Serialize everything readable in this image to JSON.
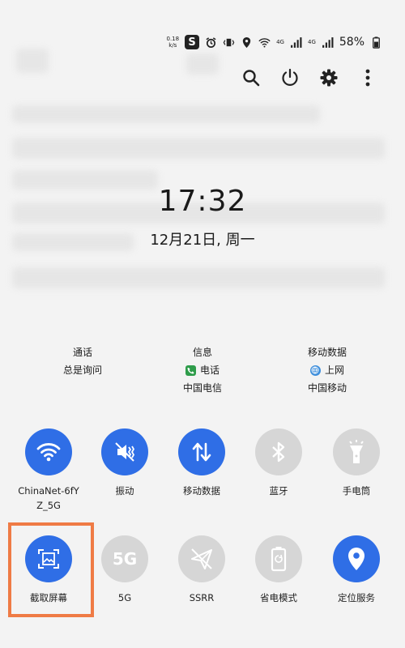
{
  "status_bar": {
    "speed": "0.18\nk/s",
    "net_type": "4G",
    "signal": "4G",
    "battery": "58%"
  },
  "top_actions": [
    {
      "name": "search-icon"
    },
    {
      "name": "power-icon"
    },
    {
      "name": "gear-icon"
    },
    {
      "name": "more-vertical-icon"
    }
  ],
  "clock": {
    "time": "17:32",
    "date": "12月21日, 周一"
  },
  "sim_info": {
    "col1": {
      "title": "通话",
      "sub": "总是询问"
    },
    "col2": {
      "title": "信息",
      "app": "电话",
      "carrier": "中国电信"
    },
    "col3": {
      "title": "移动数据",
      "app": "上网",
      "carrier": "中国移动"
    }
  },
  "tiles": [
    {
      "label": "ChinaNet-6fY\nZ_5G",
      "icon": "wifi-icon",
      "active": true
    },
    {
      "label": "振动",
      "icon": "vibrate-icon",
      "active": true
    },
    {
      "label": "移动数据",
      "icon": "mobile-data-icon",
      "active": true
    },
    {
      "label": "蓝牙",
      "icon": "bluetooth-icon",
      "active": false
    },
    {
      "label": "手电筒",
      "icon": "flashlight-icon",
      "active": false
    },
    {
      "label": "截取屏幕",
      "icon": "screenshot-icon",
      "active": true
    },
    {
      "label": "5G",
      "icon": "5g-icon",
      "active": false,
      "icon_text": "5G"
    },
    {
      "label": "SSRR",
      "icon": "ssrr-icon",
      "active": false
    },
    {
      "label": "省电模式",
      "icon": "battery-saver-icon",
      "active": false
    },
    {
      "label": "定位服务",
      "icon": "location-icon",
      "active": true
    }
  ],
  "colors": {
    "active": "#2f6ee6",
    "inactive": "#d6d6d6",
    "highlight": "#ef7b45"
  }
}
